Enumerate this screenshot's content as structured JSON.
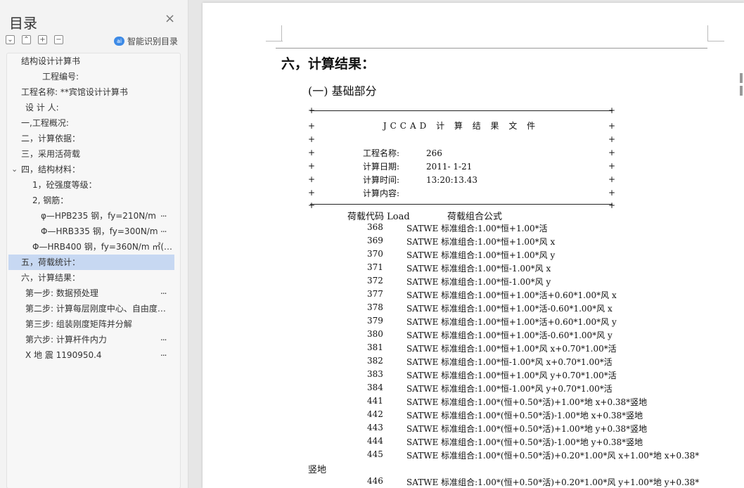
{
  "nav": {
    "title": "目录",
    "smart_label": "智能识别目录",
    "tools": [
      "⌄",
      "⌃",
      "+",
      "−"
    ],
    "items": [
      {
        "label": "结构设计计算书",
        "indent": 20
      },
      {
        "label": "工程编号:",
        "indent": 50
      },
      {
        "label": "工程名称: **宾馆设计计算书",
        "indent": 20
      },
      {
        "label": "设 计 人:",
        "indent": 26
      },
      {
        "label": "一,工程概况:",
        "indent": 20
      },
      {
        "label": "二，计算依据：",
        "indent": 20
      },
      {
        "label": "三，采用活荷载",
        "indent": 20
      },
      {
        "label": "四，结构材料：",
        "indent": 20,
        "expanded": true
      },
      {
        "label": "1，砼强度等级：",
        "indent": 36
      },
      {
        "label": "2,       钢筋：",
        "indent": 36
      },
      {
        "label": "φ—HPB235 钢，fy=210N/m",
        "indent": 48,
        "more": true
      },
      {
        "label": "Φ—HRB335 钢，fy=300N/m",
        "indent": 48,
        "more": true
      },
      {
        "label": "Φ—HRB400 钢，fy=360N/m ㎡(…",
        "indent": 36
      },
      {
        "label": "五，荷载统计：",
        "indent": 20,
        "selected": true
      },
      {
        "label": "六，计算结果：",
        "indent": 20
      },
      {
        "label": "第一步: 数据预处理",
        "indent": 26,
        "more": true
      },
      {
        "label": "第二步: 计算每层刚度中心、自由度…",
        "indent": 26
      },
      {
        "label": "第三步: 组装刚度矩阵并分解",
        "indent": 26
      },
      {
        "label": "第六步: 计算杆件内力",
        "indent": 26,
        "more": true
      },
      {
        "label": "X 地 震        1190950.4",
        "indent": 26,
        "more": true
      }
    ],
    "more_glyph": "..."
  },
  "doc": {
    "heading": "六，计算结果：",
    "subheading": "(一) 基础部分",
    "box": {
      "title": "JCCAD 计 算 结 果 文 件",
      "rows": [
        {
          "key": "工程名称:",
          "value": "266"
        },
        {
          "key": "计算日期:",
          "value": "2011- 1-21"
        },
        {
          "key": "计算时间:",
          "value": "13:20:13.43"
        },
        {
          "key": "计算内容:",
          "value": ""
        }
      ]
    },
    "load_header": {
      "code": "荷载代码 Load",
      "formula": "荷载组合公式"
    },
    "loads": [
      {
        "code": "368",
        "formula": "SATWE 标准组合:1.00*恒+1.00*活"
      },
      {
        "code": "369",
        "formula": "SATWE 标准组合:1.00*恒+1.00*风 x"
      },
      {
        "code": "370",
        "formula": "SATWE 标准组合:1.00*恒+1.00*风 y"
      },
      {
        "code": "371",
        "formula": "SATWE 标准组合:1.00*恒-1.00*风 x"
      },
      {
        "code": "372",
        "formula": "SATWE 标准组合:1.00*恒-1.00*风 y"
      },
      {
        "code": "377",
        "formula": "SATWE 标准组合:1.00*恒+1.00*活+0.60*1.00*风 x"
      },
      {
        "code": "378",
        "formula": "SATWE 标准组合:1.00*恒+1.00*活-0.60*1.00*风 x"
      },
      {
        "code": "379",
        "formula": "SATWE 标准组合:1.00*恒+1.00*活+0.60*1.00*风 y"
      },
      {
        "code": "380",
        "formula": "SATWE 标准组合:1.00*恒+1.00*活-0.60*1.00*风 y"
      },
      {
        "code": "381",
        "formula": "SATWE 标准组合:1.00*恒+1.00*风 x+0.70*1.00*活"
      },
      {
        "code": "382",
        "formula": "SATWE 标准组合:1.00*恒-1.00*风 x+0.70*1.00*活"
      },
      {
        "code": "383",
        "formula": "SATWE 标准组合:1.00*恒+1.00*风 y+0.70*1.00*活"
      },
      {
        "code": "384",
        "formula": "SATWE 标准组合:1.00*恒-1.00*风 y+0.70*1.00*活"
      },
      {
        "code": "441",
        "formula": "SATWE 标准组合:1.00*(恒+0.50*活)+1.00*地 x+0.38*竖地"
      },
      {
        "code": "442",
        "formula": "SATWE 标准组合:1.00*(恒+0.50*活)-1.00*地 x+0.38*竖地"
      },
      {
        "code": "443",
        "formula": "SATWE 标准组合:1.00*(恒+0.50*活)+1.00*地 y+0.38*竖地"
      },
      {
        "code": "444",
        "formula": "SATWE 标准组合:1.00*(恒+0.50*活)-1.00*地 y+0.38*竖地"
      },
      {
        "code": "445",
        "formula": "SATWE 标准组合:1.00*(恒+0.50*活)+0.20*1.00*风 x+1.00*地 x+0.38*"
      },
      {
        "code": "446",
        "formula": "SATWE 标准组合:1.00*(恒+0.50*活)+0.20*1.00*风 y+1.00*地 y+0.38*"
      }
    ],
    "wrap_continuation": "竖地"
  }
}
